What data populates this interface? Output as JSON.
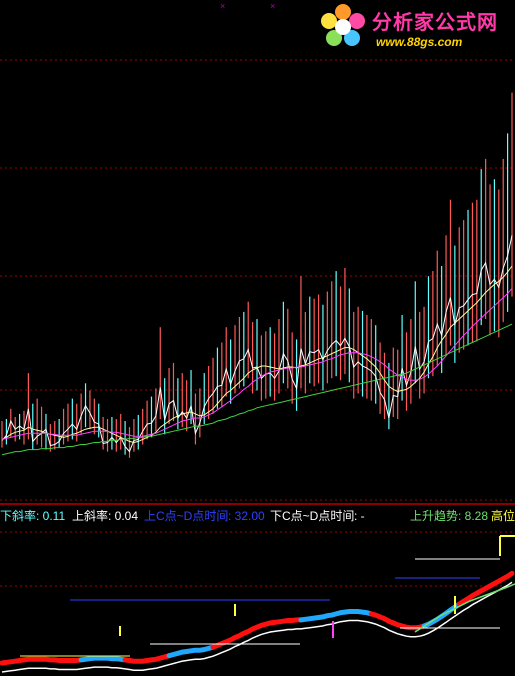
{
  "logo": {
    "title": "分析家公式网",
    "url": "www.88gs.com",
    "icon": "flower-logo-icon"
  },
  "markers": [
    "×",
    "×"
  ],
  "legend": {
    "down_slope_label": "下斜率",
    "down_slope_value": ": 0.11",
    "up_slope_label": "上斜率",
    "up_slope_value": ": 0.04",
    "cd_up_label": "上C点~D点时间",
    "cd_up_value": ": 32.00",
    "cd_down_label": "下C点~D点时间",
    "cd_down_value": ": -",
    "trend_label": "上升趋势",
    "trend_value": ": 8.28",
    "high_label": "高位"
  },
  "colors": {
    "background": "#000000",
    "grid": "#a00000",
    "up_bar": "#ff5a5a",
    "down_bar": "#60ffff",
    "ma_short": "#ffffff",
    "ma_mid": "#ffffa0",
    "ma_long": "#ff40ff",
    "ma_trend": "#40d040",
    "ind_red": "#ff1010",
    "ind_blue": "#20a8ff",
    "ind_white": "#ffffff",
    "ind_yellow": "#ffff40",
    "ind_green": "#70e070",
    "ind_navy": "#3040ff"
  },
  "chart_data": {
    "type": "line",
    "series": [
      {
        "values": [
          0.59,
          0.64,
          0.78,
          0.7,
          0.73,
          0.7,
          0.9,
          0.58,
          0.63,
          0.66,
          0.7,
          0.54,
          0.55,
          0.58,
          0.66,
          0.7,
          0.75,
          0.7,
          0.83,
          0.93,
          0.86,
          0.77,
          0.75,
          0.56,
          0.57,
          0.62,
          0.57,
          0.62,
          0.53,
          0.48,
          0.59,
          0.6,
          0.68,
          0.75,
          0.76,
          0.83,
          1.11,
          0.79,
          0.95,
          0.98,
          0.81,
          0.87,
          0.81,
          0.93,
          0.66,
          0.76,
          0.92,
          1.0,
          1.05,
          1.12,
          1.13,
          1.29,
          1.14,
          1.27,
          1.37,
          1.39,
          1.48,
          1.3,
          1.31,
          1.2,
          1.24,
          1.25,
          1.2,
          1.27,
          1.44,
          1.37,
          1.19,
          1.1,
          1.49,
          1.34,
          1.46,
          1.45,
          1.48,
          1.38,
          1.47,
          1.53,
          1.57,
          1.52,
          1.59,
          1.51,
          1.31,
          1.36,
          1.32,
          1.3,
          1.27,
          1.22,
          1.06,
          0.99,
          0.81,
          1.03,
          1.02,
          1.3,
          1.13,
          1.26,
          1.51,
          1.29,
          1.36,
          1.56,
          1.59,
          1.73,
          1.62,
          1.85,
          1.99,
          1.72,
          1.89,
          1.91,
          1.97,
          2.02,
          2.03,
          2.26,
          2.33,
          2.12,
          2.17,
          2.09,
          2.28,
          2.4,
          2.6
        ]
      },
      {
        "values": [
          0.6,
          0.62,
          0.65,
          0.67,
          0.68,
          0.69,
          0.72,
          0.7,
          0.69,
          0.68,
          0.66,
          0.65,
          0.64,
          0.63,
          0.62,
          0.63,
          0.65,
          0.66,
          0.68,
          0.7,
          0.71,
          0.72,
          0.72,
          0.7,
          0.68,
          0.66,
          0.64,
          0.62,
          0.6,
          0.58,
          0.57,
          0.58,
          0.6,
          0.62,
          0.64,
          0.67,
          0.72,
          0.75,
          0.78,
          0.81,
          0.83,
          0.85,
          0.86,
          0.87,
          0.85,
          0.83,
          0.84,
          0.87,
          0.9,
          0.95,
          1.0,
          1.05,
          1.08,
          1.12,
          1.16,
          1.2,
          1.25,
          1.28,
          1.3,
          1.32,
          1.32,
          1.31,
          1.3,
          1.29,
          1.3,
          1.31,
          1.31,
          1.3,
          1.32,
          1.33,
          1.35,
          1.37,
          1.39,
          1.4,
          1.42,
          1.44,
          1.46,
          1.48,
          1.5,
          1.5,
          1.48,
          1.45,
          1.42,
          1.39,
          1.35,
          1.31,
          1.25,
          1.18,
          1.12,
          1.09,
          1.07,
          1.08,
          1.09,
          1.12,
          1.16,
          1.2,
          1.26,
          1.34,
          1.41,
          1.5,
          1.57,
          1.63,
          1.7,
          1.74,
          1.78,
          1.82,
          1.86,
          1.9,
          1.94,
          1.99,
          2.04,
          2.08,
          2.12,
          2.15,
          2.19,
          2.24,
          2.3
        ]
      },
      {
        "values": [
          0.6,
          0.61,
          0.62,
          0.63,
          0.64,
          0.65,
          0.66,
          0.66,
          0.66,
          0.66,
          0.66,
          0.65,
          0.65,
          0.64,
          0.64,
          0.64,
          0.64,
          0.64,
          0.65,
          0.66,
          0.67,
          0.68,
          0.68,
          0.68,
          0.68,
          0.67,
          0.67,
          0.66,
          0.65,
          0.64,
          0.63,
          0.63,
          0.63,
          0.64,
          0.65,
          0.66,
          0.68,
          0.7,
          0.72,
          0.74,
          0.76,
          0.78,
          0.79,
          0.8,
          0.81,
          0.81,
          0.82,
          0.84,
          0.86,
          0.89,
          0.92,
          0.95,
          0.98,
          1.02,
          1.05,
          1.09,
          1.12,
          1.16,
          1.19,
          1.22,
          1.24,
          1.26,
          1.27,
          1.28,
          1.29,
          1.3,
          1.3,
          1.31,
          1.31,
          1.32,
          1.33,
          1.34,
          1.35,
          1.36,
          1.38,
          1.39,
          1.41,
          1.43,
          1.44,
          1.45,
          1.45,
          1.45,
          1.44,
          1.43,
          1.41,
          1.39,
          1.36,
          1.33,
          1.29,
          1.26,
          1.23,
          1.21,
          1.19,
          1.18,
          1.18,
          1.19,
          1.21,
          1.24,
          1.28,
          1.32,
          1.37,
          1.42,
          1.47,
          1.52,
          1.57,
          1.62,
          1.66,
          1.71,
          1.75,
          1.79,
          1.83,
          1.87,
          1.91,
          1.95,
          1.99,
          2.03,
          2.08
        ]
      },
      {
        "values": [
          0.45,
          0.46,
          0.47,
          0.48,
          0.48,
          0.49,
          0.5,
          0.5,
          0.5,
          0.51,
          0.51,
          0.51,
          0.52,
          0.52,
          0.52,
          0.53,
          0.53,
          0.54,
          0.55,
          0.55,
          0.56,
          0.57,
          0.57,
          0.58,
          0.58,
          0.59,
          0.59,
          0.6,
          0.6,
          0.61,
          0.61,
          0.62,
          0.62,
          0.63,
          0.63,
          0.64,
          0.65,
          0.66,
          0.67,
          0.68,
          0.69,
          0.7,
          0.71,
          0.72,
          0.73,
          0.73,
          0.74,
          0.75,
          0.76,
          0.78,
          0.79,
          0.8,
          0.82,
          0.83,
          0.85,
          0.86,
          0.88,
          0.89,
          0.91,
          0.92,
          0.93,
          0.94,
          0.95,
          0.96,
          0.97,
          0.98,
          0.99,
          1.0,
          1.01,
          1.02,
          1.03,
          1.04,
          1.05,
          1.06,
          1.07,
          1.08,
          1.09,
          1.1,
          1.11,
          1.12,
          1.13,
          1.14,
          1.15,
          1.16,
          1.17,
          1.18,
          1.19,
          1.2,
          1.21,
          1.22,
          1.23,
          1.24,
          1.25,
          1.27,
          1.29,
          1.31,
          1.33,
          1.35,
          1.37,
          1.39,
          1.41,
          1.43,
          1.45,
          1.47,
          1.49,
          1.51,
          1.53,
          1.55,
          1.57,
          1.59,
          1.61,
          1.63,
          1.65,
          1.67,
          1.69,
          1.71,
          1.73
        ]
      },
      {
        "values": [
          0.38,
          0.39,
          0.4,
          0.4,
          0.41,
          0.42,
          0.42,
          0.43,
          0.44,
          0.44,
          0.45,
          0.46,
          0.46,
          0.47,
          0.48,
          0.49,
          0.5,
          0.51,
          0.52,
          0.53,
          0.54,
          0.55,
          0.56,
          0.57,
          0.58,
          0.59,
          0.6,
          0.61,
          0.62,
          0.63,
          0.64,
          0.65,
          0.66,
          0.67,
          0.68,
          0.69,
          0.7,
          0.71,
          0.72,
          0.73,
          0.74,
          0.75,
          0.76,
          0.77,
          0.78,
          0.79,
          0.8,
          0.81,
          0.82,
          0.83,
          0.84,
          0.85,
          0.86,
          0.87,
          0.88,
          0.89,
          0.9,
          0.91,
          0.92,
          0.93,
          0.94,
          0.95,
          0.96,
          0.97,
          0.98,
          0.99,
          1.0,
          1.01,
          1.02,
          1.03,
          1.04,
          1.05,
          1.06,
          1.07,
          1.08,
          1.09,
          1.1,
          1.11,
          1.12,
          1.13,
          1.14,
          1.15,
          1.16,
          1.17,
          1.18,
          1.19,
          1.2,
          1.22,
          1.24,
          1.26,
          1.28,
          1.3,
          1.32,
          1.34,
          1.36,
          1.38,
          1.4,
          1.42,
          1.44,
          1.46,
          1.48,
          1.5,
          1.52,
          1.54,
          1.56,
          1.58,
          1.6,
          1.62,
          1.64,
          1.66,
          1.68,
          1.7,
          1.72,
          1.74,
          1.76,
          1.78,
          1.8
        ]
      }
    ],
    "bar_ranges": [
      [
        0.52,
        0.78
      ],
      [
        0.55,
        0.8
      ],
      [
        0.62,
        0.9
      ],
      [
        0.58,
        0.82
      ],
      [
        0.6,
        0.85
      ],
      [
        0.55,
        0.88
      ],
      [
        0.6,
        1.25
      ],
      [
        0.5,
        0.95
      ],
      [
        0.55,
        1.0
      ],
      [
        0.52,
        0.92
      ],
      [
        0.5,
        0.85
      ],
      [
        0.48,
        0.75
      ],
      [
        0.5,
        0.78
      ],
      [
        0.52,
        0.8
      ],
      [
        0.55,
        0.9
      ],
      [
        0.58,
        0.95
      ],
      [
        0.6,
        1.0
      ],
      [
        0.58,
        0.95
      ],
      [
        0.65,
        1.05
      ],
      [
        0.72,
        1.15
      ],
      [
        0.7,
        1.08
      ],
      [
        0.65,
        1.0
      ],
      [
        0.62,
        0.95
      ],
      [
        0.5,
        0.82
      ],
      [
        0.48,
        0.8
      ],
      [
        0.5,
        0.82
      ],
      [
        0.48,
        0.8
      ],
      [
        0.5,
        0.85
      ],
      [
        0.45,
        0.78
      ],
      [
        0.42,
        0.72
      ],
      [
        0.48,
        0.8
      ],
      [
        0.5,
        0.84
      ],
      [
        0.55,
        0.9
      ],
      [
        0.6,
        0.98
      ],
      [
        0.62,
        1.02
      ],
      [
        0.68,
        1.1
      ],
      [
        0.8,
        1.7
      ],
      [
        0.65,
        1.2
      ],
      [
        0.75,
        1.3
      ],
      [
        0.78,
        1.35
      ],
      [
        0.7,
        1.2
      ],
      [
        0.72,
        1.25
      ],
      [
        0.68,
        1.18
      ],
      [
        0.75,
        1.28
      ],
      [
        0.55,
        1.05
      ],
      [
        0.62,
        1.1
      ],
      [
        0.75,
        1.25
      ],
      [
        0.8,
        1.32
      ],
      [
        0.85,
        1.4
      ],
      [
        0.9,
        1.5
      ],
      [
        0.92,
        1.55
      ],
      [
        1.02,
        1.7
      ],
      [
        0.95,
        1.58
      ],
      [
        1.05,
        1.72
      ],
      [
        1.1,
        1.8
      ],
      [
        1.12,
        1.85
      ],
      [
        1.2,
        1.95
      ],
      [
        1.05,
        1.75
      ],
      [
        1.08,
        1.78
      ],
      [
        0.98,
        1.62
      ],
      [
        1.0,
        1.66
      ],
      [
        1.02,
        1.7
      ],
      [
        0.98,
        1.64
      ],
      [
        1.05,
        1.78
      ],
      [
        1.15,
        1.95
      ],
      [
        1.1,
        1.88
      ],
      [
        0.95,
        1.65
      ],
      [
        0.88,
        1.58
      ],
      [
        1.1,
        2.2
      ],
      [
        1.05,
        1.85
      ],
      [
        1.15,
        2.0
      ],
      [
        1.12,
        1.98
      ],
      [
        1.15,
        2.02
      ],
      [
        1.08,
        1.92
      ],
      [
        1.15,
        2.05
      ],
      [
        1.2,
        2.15
      ],
      [
        1.22,
        2.25
      ],
      [
        1.18,
        2.1
      ],
      [
        1.24,
        2.28
      ],
      [
        1.16,
        2.08
      ],
      [
        1.0,
        1.85
      ],
      [
        1.05,
        1.9
      ],
      [
        1.02,
        1.86
      ],
      [
        1.0,
        1.82
      ],
      [
        0.98,
        1.78
      ],
      [
        0.95,
        1.72
      ],
      [
        0.85,
        1.55
      ],
      [
        0.8,
        1.45
      ],
      [
        0.7,
        1.35
      ],
      [
        0.82,
        1.5
      ],
      [
        0.8,
        1.48
      ],
      [
        0.98,
        1.82
      ],
      [
        0.88,
        1.65
      ],
      [
        0.95,
        1.78
      ],
      [
        1.15,
        2.15
      ],
      [
        1.0,
        1.85
      ],
      [
        1.05,
        1.9
      ],
      [
        1.2,
        2.2
      ],
      [
        1.22,
        2.25
      ],
      [
        1.32,
        2.45
      ],
      [
        1.25,
        2.3
      ],
      [
        1.42,
        2.6
      ],
      [
        1.52,
        2.95
      ],
      [
        1.35,
        2.5
      ],
      [
        1.45,
        2.68
      ],
      [
        1.48,
        2.75
      ],
      [
        1.52,
        2.85
      ],
      [
        1.55,
        2.92
      ],
      [
        1.56,
        2.95
      ],
      [
        1.72,
        3.25
      ],
      [
        1.78,
        3.35
      ],
      [
        1.62,
        3.1
      ],
      [
        1.66,
        3.15
      ],
      [
        1.6,
        3.05
      ],
      [
        1.75,
        3.35
      ],
      [
        1.85,
        3.6
      ],
      [
        2.0,
        4.0
      ]
    ]
  }
}
